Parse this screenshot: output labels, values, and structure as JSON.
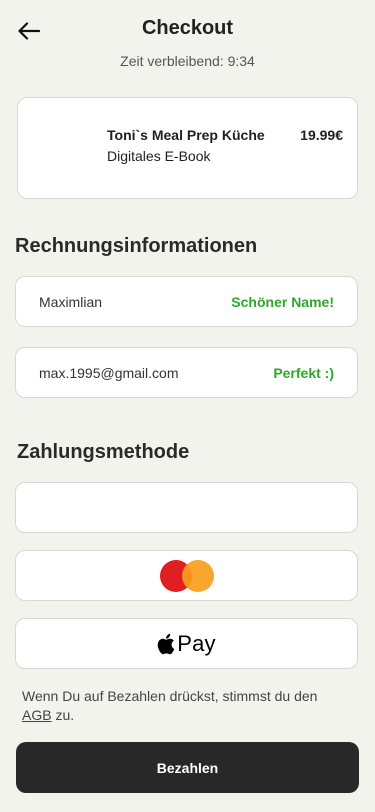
{
  "header": {
    "title": "Checkout",
    "timer_label": "Zeit verbleibend: 9:34"
  },
  "product": {
    "name": "Toni`s Meal Prep Küche",
    "type": "Digitales E-Book",
    "price": "19.99€"
  },
  "billing": {
    "section_title": "Rechnungsinformationen",
    "name_value": "Maximlian",
    "name_hint": "Schöner Name!",
    "email_value": "max.1995@gmail.com",
    "email_hint": "Perfekt :)"
  },
  "payment": {
    "section_title": "Zahlungsmethode",
    "apple_pay_label": "Pay"
  },
  "terms": {
    "prefix": "Wenn Du auf Bezahlen drückst, stimmst du den",
    "link": "AGB",
    "suffix": "zu."
  },
  "submit": {
    "label": "Bezahlen"
  },
  "colors": {
    "background": "#f3f3ee",
    "success": "#2fa82a",
    "button": "#282828"
  }
}
